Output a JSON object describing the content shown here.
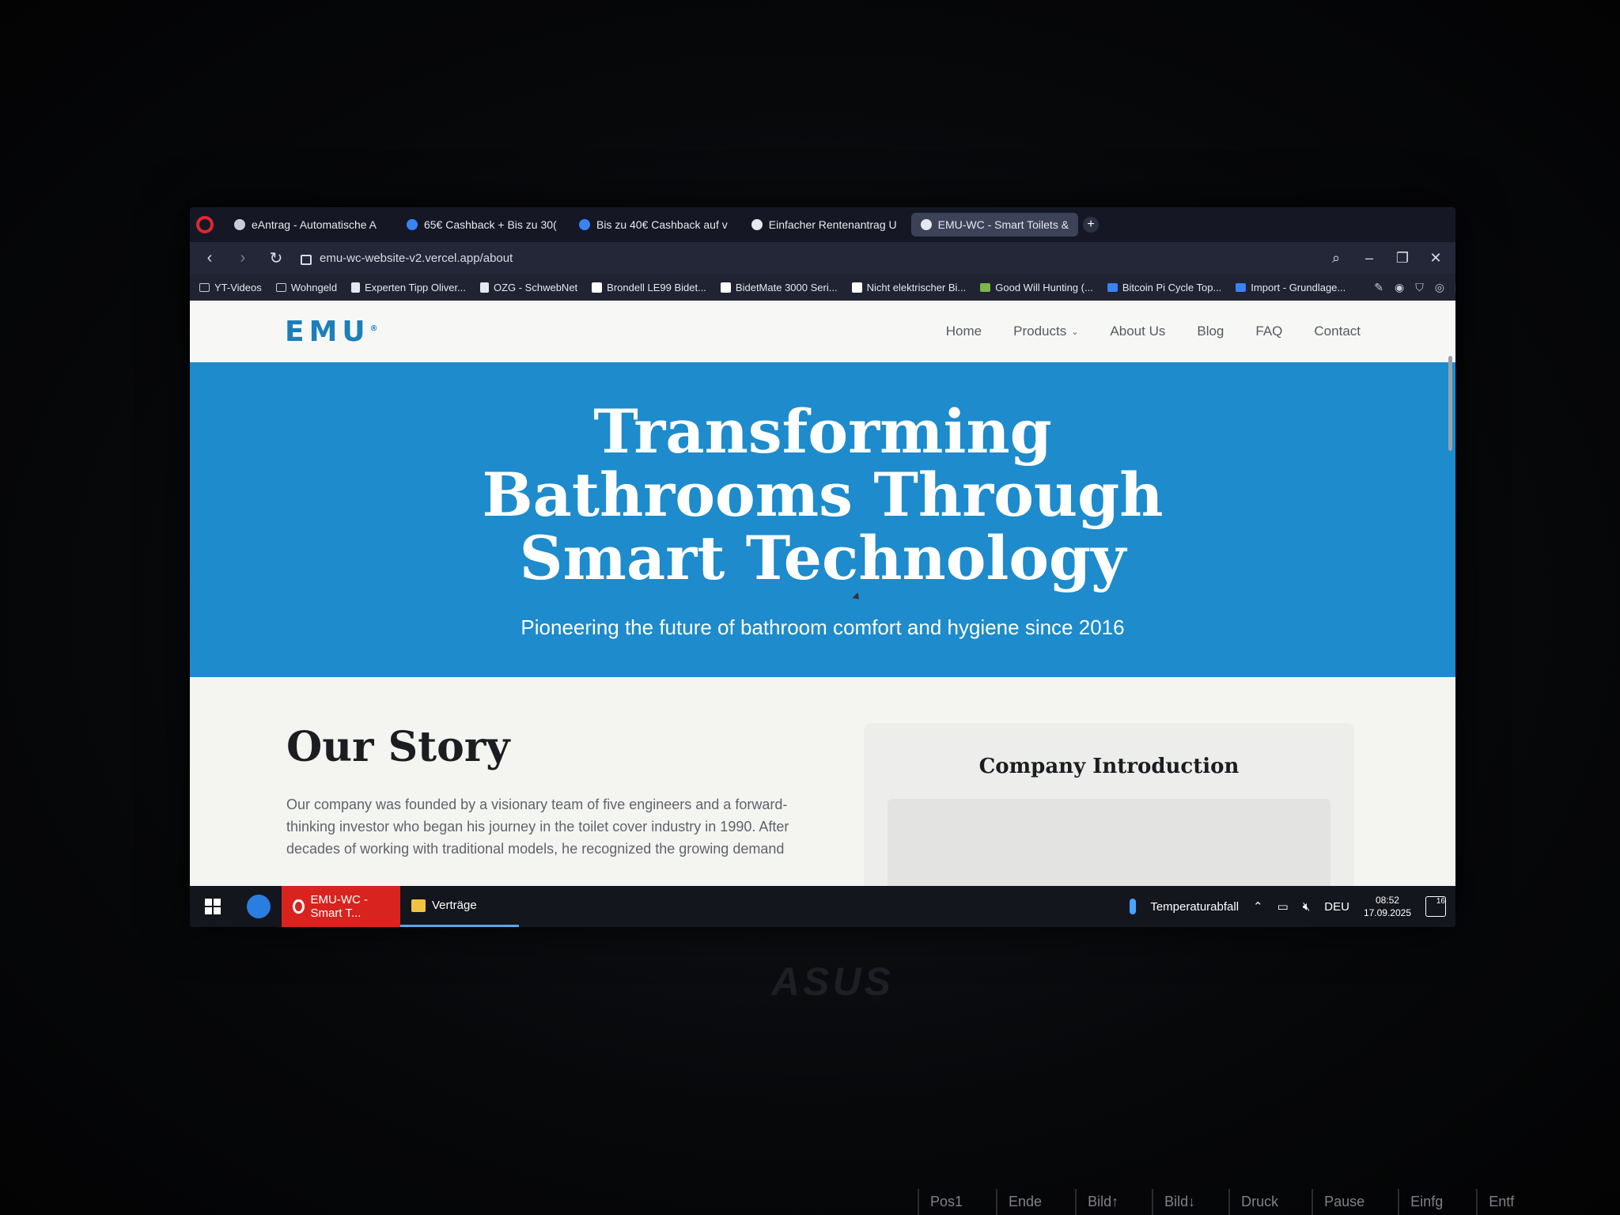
{
  "browser": {
    "tabs": [
      {
        "label": "eAntrag - Automatische A",
        "icon": "web-favicon",
        "active": false
      },
      {
        "label": "65€ Cashback + Bis zu 30(",
        "icon": "cashback-favicon",
        "active": false
      },
      {
        "label": "Bis zu 40€ Cashback auf v",
        "icon": "cashback-favicon",
        "active": false
      },
      {
        "label": "Einfacher Rentenantrag U",
        "icon": "web-favicon",
        "active": false
      },
      {
        "label": "EMU-WC - Smart Toilets &",
        "icon": "web-favicon",
        "active": true
      }
    ],
    "new_tab": "+",
    "url": "emu-wc-website-v2.vercel.app/about",
    "bookmarks": [
      {
        "label": "YT-Videos",
        "icon": "folder-icon"
      },
      {
        "label": "Wohngeld",
        "icon": "folder-icon"
      },
      {
        "label": "Experten Tipp Oliver...",
        "icon": "page-icon"
      },
      {
        "label": "OZG - SchwebNet",
        "icon": "page-icon"
      },
      {
        "label": "Brondell LE99 Bidet...",
        "icon": "amazon-icon"
      },
      {
        "label": "BidetMate 3000 Seri...",
        "icon": "amazon-icon"
      },
      {
        "label": "Nicht elektrischer Bi...",
        "icon": "amazon-icon"
      },
      {
        "label": "Good Will Hunting (...",
        "icon": "image-icon"
      },
      {
        "label": "Bitcoin Pi Cycle Top...",
        "icon": "chart-icon"
      },
      {
        "label": "Import - Grundlage...",
        "icon": "web-icon"
      }
    ],
    "overflow": "»"
  },
  "site": {
    "logo": "EMU",
    "logo_mark": "®",
    "nav": [
      "Home",
      "Products",
      "About Us",
      "Blog",
      "FAQ",
      "Contact"
    ],
    "hero_title": "Transforming Bathrooms Through Smart Technology",
    "hero_subtitle": "Pioneering the future of bathroom comfort and hygiene since 2016",
    "story_heading": "Our Story",
    "story_text": "Our company was founded by a visionary team of five engineers and a forward-thinking investor who began his journey in the toilet cover industry in 1990. After decades of working with traditional models, he recognized the growing demand",
    "card_heading": "Company Introduction"
  },
  "taskbar": {
    "tasks": [
      "EMU-WC - Smart T...",
      "Verträge"
    ],
    "weather": "Temperaturabfall",
    "language": "DEU",
    "time": "08:52",
    "date": "17.09.2025",
    "notifications": "16"
  },
  "device": {
    "brand": "ASUS",
    "keys": [
      "Pos1",
      "Ende",
      "Bild↑",
      "Bild↓",
      "Druck",
      "Pause",
      "Einfg",
      "Entf"
    ]
  },
  "colors": {
    "hero_bg": "#1d8bcc",
    "brand": "#1c7fb9",
    "opera_red": "#d9231f"
  }
}
